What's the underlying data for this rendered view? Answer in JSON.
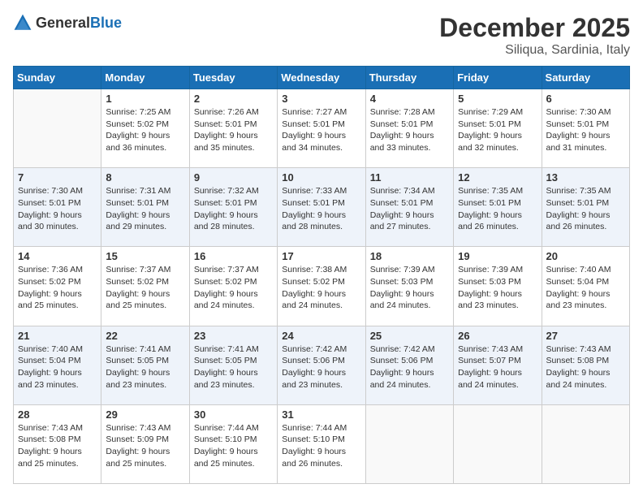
{
  "logo": {
    "general": "General",
    "blue": "Blue"
  },
  "title": "December 2025",
  "location": "Siliqua, Sardinia, Italy",
  "weekdays": [
    "Sunday",
    "Monday",
    "Tuesday",
    "Wednesday",
    "Thursday",
    "Friday",
    "Saturday"
  ],
  "weeks": [
    [
      {
        "day": "",
        "info": ""
      },
      {
        "day": "1",
        "info": "Sunrise: 7:25 AM\nSunset: 5:02 PM\nDaylight: 9 hours\nand 36 minutes."
      },
      {
        "day": "2",
        "info": "Sunrise: 7:26 AM\nSunset: 5:01 PM\nDaylight: 9 hours\nand 35 minutes."
      },
      {
        "day": "3",
        "info": "Sunrise: 7:27 AM\nSunset: 5:01 PM\nDaylight: 9 hours\nand 34 minutes."
      },
      {
        "day": "4",
        "info": "Sunrise: 7:28 AM\nSunset: 5:01 PM\nDaylight: 9 hours\nand 33 minutes."
      },
      {
        "day": "5",
        "info": "Sunrise: 7:29 AM\nSunset: 5:01 PM\nDaylight: 9 hours\nand 32 minutes."
      },
      {
        "day": "6",
        "info": "Sunrise: 7:30 AM\nSunset: 5:01 PM\nDaylight: 9 hours\nand 31 minutes."
      }
    ],
    [
      {
        "day": "7",
        "info": "Sunrise: 7:30 AM\nSunset: 5:01 PM\nDaylight: 9 hours\nand 30 minutes."
      },
      {
        "day": "8",
        "info": "Sunrise: 7:31 AM\nSunset: 5:01 PM\nDaylight: 9 hours\nand 29 minutes."
      },
      {
        "day": "9",
        "info": "Sunrise: 7:32 AM\nSunset: 5:01 PM\nDaylight: 9 hours\nand 28 minutes."
      },
      {
        "day": "10",
        "info": "Sunrise: 7:33 AM\nSunset: 5:01 PM\nDaylight: 9 hours\nand 28 minutes."
      },
      {
        "day": "11",
        "info": "Sunrise: 7:34 AM\nSunset: 5:01 PM\nDaylight: 9 hours\nand 27 minutes."
      },
      {
        "day": "12",
        "info": "Sunrise: 7:35 AM\nSunset: 5:01 PM\nDaylight: 9 hours\nand 26 minutes."
      },
      {
        "day": "13",
        "info": "Sunrise: 7:35 AM\nSunset: 5:01 PM\nDaylight: 9 hours\nand 26 minutes."
      }
    ],
    [
      {
        "day": "14",
        "info": "Sunrise: 7:36 AM\nSunset: 5:02 PM\nDaylight: 9 hours\nand 25 minutes."
      },
      {
        "day": "15",
        "info": "Sunrise: 7:37 AM\nSunset: 5:02 PM\nDaylight: 9 hours\nand 25 minutes."
      },
      {
        "day": "16",
        "info": "Sunrise: 7:37 AM\nSunset: 5:02 PM\nDaylight: 9 hours\nand 24 minutes."
      },
      {
        "day": "17",
        "info": "Sunrise: 7:38 AM\nSunset: 5:02 PM\nDaylight: 9 hours\nand 24 minutes."
      },
      {
        "day": "18",
        "info": "Sunrise: 7:39 AM\nSunset: 5:03 PM\nDaylight: 9 hours\nand 24 minutes."
      },
      {
        "day": "19",
        "info": "Sunrise: 7:39 AM\nSunset: 5:03 PM\nDaylight: 9 hours\nand 23 minutes."
      },
      {
        "day": "20",
        "info": "Sunrise: 7:40 AM\nSunset: 5:04 PM\nDaylight: 9 hours\nand 23 minutes."
      }
    ],
    [
      {
        "day": "21",
        "info": "Sunrise: 7:40 AM\nSunset: 5:04 PM\nDaylight: 9 hours\nand 23 minutes."
      },
      {
        "day": "22",
        "info": "Sunrise: 7:41 AM\nSunset: 5:05 PM\nDaylight: 9 hours\nand 23 minutes."
      },
      {
        "day": "23",
        "info": "Sunrise: 7:41 AM\nSunset: 5:05 PM\nDaylight: 9 hours\nand 23 minutes."
      },
      {
        "day": "24",
        "info": "Sunrise: 7:42 AM\nSunset: 5:06 PM\nDaylight: 9 hours\nand 23 minutes."
      },
      {
        "day": "25",
        "info": "Sunrise: 7:42 AM\nSunset: 5:06 PM\nDaylight: 9 hours\nand 24 minutes."
      },
      {
        "day": "26",
        "info": "Sunrise: 7:43 AM\nSunset: 5:07 PM\nDaylight: 9 hours\nand 24 minutes."
      },
      {
        "day": "27",
        "info": "Sunrise: 7:43 AM\nSunset: 5:08 PM\nDaylight: 9 hours\nand 24 minutes."
      }
    ],
    [
      {
        "day": "28",
        "info": "Sunrise: 7:43 AM\nSunset: 5:08 PM\nDaylight: 9 hours\nand 25 minutes."
      },
      {
        "day": "29",
        "info": "Sunrise: 7:43 AM\nSunset: 5:09 PM\nDaylight: 9 hours\nand 25 minutes."
      },
      {
        "day": "30",
        "info": "Sunrise: 7:44 AM\nSunset: 5:10 PM\nDaylight: 9 hours\nand 25 minutes."
      },
      {
        "day": "31",
        "info": "Sunrise: 7:44 AM\nSunset: 5:10 PM\nDaylight: 9 hours\nand 26 minutes."
      },
      {
        "day": "",
        "info": ""
      },
      {
        "day": "",
        "info": ""
      },
      {
        "day": "",
        "info": ""
      }
    ]
  ],
  "colors": {
    "header_bg": "#1a6fb5",
    "row_alt": "#eef3fa"
  }
}
